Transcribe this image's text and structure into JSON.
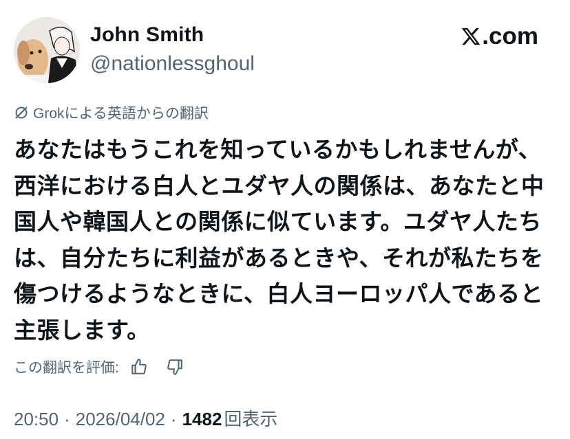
{
  "author": {
    "display_name": "John Smith",
    "handle": "@nationlessghoul",
    "avatar": "profile-photo-dog-and-anime-character"
  },
  "brand": {
    "icon": "x-logo-icon",
    "text": ".com"
  },
  "translation": {
    "icon": "grok-icon",
    "label": "Grokによる英語からの翻訳"
  },
  "tweet": {
    "lines": [
      "あなたはもうこれを知っているかもしれませんが、",
      "西洋における白人とユダヤ人の関係は、あなたと中",
      "国人や韓国人との関係に似ています。ユダヤ人たち",
      "は、自分たちに利益があるときや、それが私たちを",
      "傷つけるようなときに、白人ヨーロッパ人であると",
      "主張します。"
    ]
  },
  "rating": {
    "label": "この翻訳を評価:",
    "like_icon": "thumbs-up-icon",
    "dislike_icon": "thumbs-down-icon"
  },
  "meta": {
    "time": "20:50",
    "separator": "·",
    "date": "2026/04/02",
    "views_count": "1482",
    "views_label": "回表示"
  },
  "colors": {
    "text": "#0f1419",
    "secondary": "#536471",
    "background": "#ffffff"
  }
}
